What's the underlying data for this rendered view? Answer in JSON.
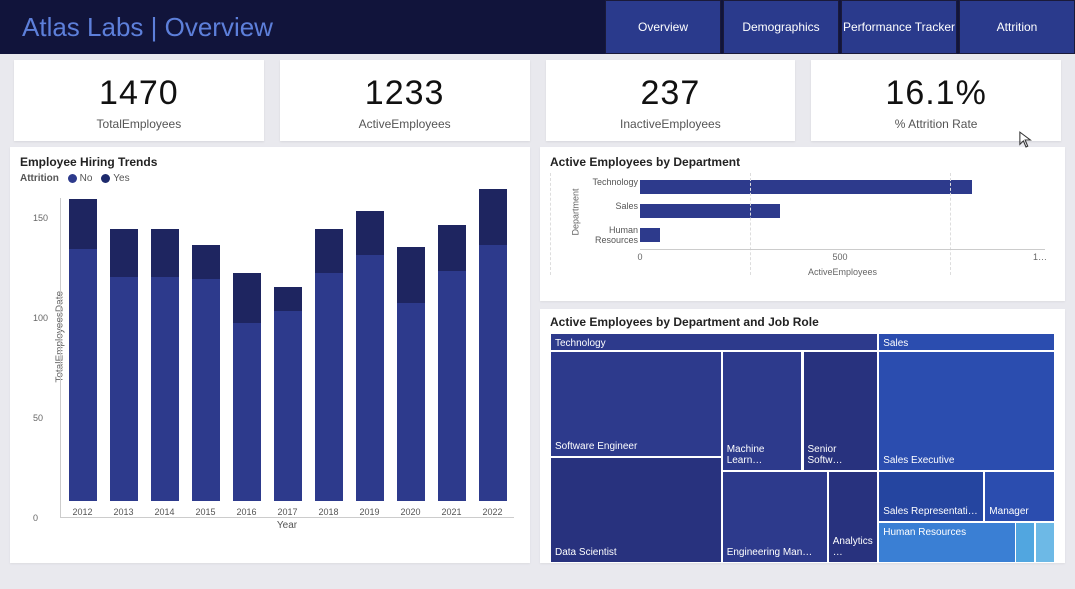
{
  "header": {
    "title": "Atlas Labs | Overview",
    "tabs": [
      "Overview",
      "Demographics",
      "Performance Tracker",
      "Attrition"
    ]
  },
  "kpis": [
    {
      "value": "1470",
      "label": "TotalEmployees"
    },
    {
      "value": "1233",
      "label": "ActiveEmployees"
    },
    {
      "value": "237",
      "label": "InactiveEmployees"
    },
    {
      "value": "16.1%",
      "label": "% Attrition Rate"
    }
  ],
  "hiring": {
    "title": "Employee Hiring Trends",
    "legend_label": "Attrition",
    "legend_no": "No",
    "legend_yes": "Yes",
    "y_label": "TotalEmployeesDate",
    "x_label": "Year"
  },
  "deptBar": {
    "title": "Active Employees by Department",
    "y_label": "Department",
    "x_label": "ActiveEmployees"
  },
  "treemap": {
    "title": "Active Employees by Department and Job Role",
    "tech": "Technology",
    "sales": "Sales",
    "hr": "Human Resources",
    "roles": {
      "se": "Software Engineer",
      "ds": "Data Scientist",
      "ml": "Machine Learn…",
      "ssw": "Senior Softw…",
      "em": "Engineering Man…",
      "am": "Analytics …",
      "sexec": "Sales Executive",
      "srep": "Sales Representati…",
      "mgr": "Manager"
    }
  },
  "chart_data": [
    {
      "type": "bar",
      "stacked": true,
      "title": "Employee Hiring Trends",
      "xlabel": "Year",
      "ylabel": "TotalEmployeesDate",
      "ylim": [
        0,
        160
      ],
      "yticks": [
        0,
        50,
        100,
        150
      ],
      "categories": [
        "2012",
        "2013",
        "2014",
        "2015",
        "2016",
        "2017",
        "2018",
        "2019",
        "2020",
        "2021",
        "2022"
      ],
      "series": [
        {
          "name": "No",
          "values": [
            126,
            112,
            112,
            111,
            89,
            95,
            114,
            123,
            99,
            115,
            128
          ]
        },
        {
          "name": "Yes",
          "values": [
            25,
            24,
            24,
            17,
            25,
            12,
            22,
            22,
            28,
            23,
            28
          ]
        }
      ],
      "totals": [
        151,
        136,
        136,
        128,
        114,
        107,
        136,
        145,
        127,
        138,
        156
      ]
    },
    {
      "type": "bar",
      "orientation": "horizontal",
      "title": "Active Employees by Department",
      "xlabel": "ActiveEmployees",
      "ylabel": "Department",
      "xlim": [
        0,
        1000
      ],
      "xticks": [
        0,
        500,
        "1…"
      ],
      "categories": [
        "Technology",
        "Sales",
        "Human Resources"
      ],
      "values": [
        830,
        350,
        50
      ]
    },
    {
      "type": "treemap",
      "title": "Active Employees by Department and Job Role",
      "nodes": [
        {
          "name": "Technology",
          "children": [
            {
              "name": "Software Engineer"
            },
            {
              "name": "Data Scientist"
            },
            {
              "name": "Machine Learn…"
            },
            {
              "name": "Senior Softw…"
            },
            {
              "name": "Engineering Man…"
            },
            {
              "name": "Analytics …"
            }
          ]
        },
        {
          "name": "Sales",
          "children": [
            {
              "name": "Sales Executive"
            },
            {
              "name": "Sales Representati…"
            },
            {
              "name": "Manager"
            }
          ]
        },
        {
          "name": "Human Resources",
          "children": []
        }
      ]
    }
  ]
}
